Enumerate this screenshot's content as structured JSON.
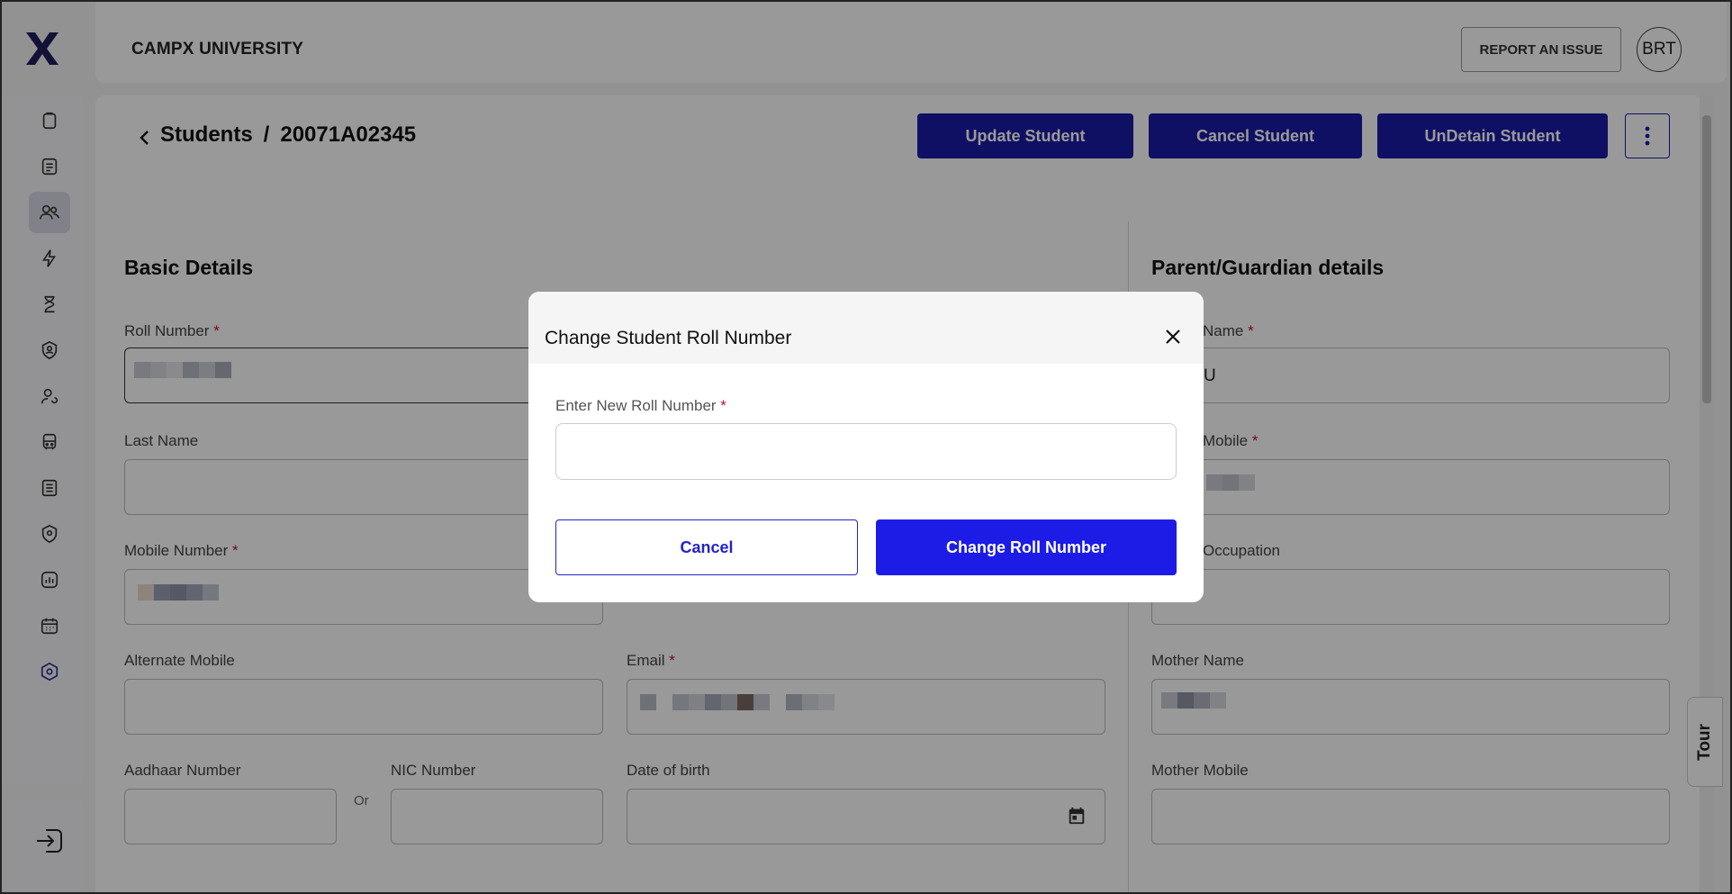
{
  "header": {
    "university": "CAMPX UNIVERSITY",
    "report_label": "REPORT AN ISSUE",
    "avatar_initials": "BRT"
  },
  "sidebar": {
    "items": [
      {
        "icon": "clipboard-icon"
      },
      {
        "icon": "document-icon"
      },
      {
        "icon": "users-icon",
        "active": true
      },
      {
        "icon": "lightning-icon"
      },
      {
        "icon": "hourglass-icon"
      },
      {
        "icon": "shield-user-icon"
      },
      {
        "icon": "user-refresh-icon"
      },
      {
        "icon": "bus-icon"
      },
      {
        "icon": "receipt-icon"
      },
      {
        "icon": "location-shield-icon"
      },
      {
        "icon": "chart-icon"
      },
      {
        "icon": "calendar-icon"
      },
      {
        "icon": "settings-hex-icon"
      }
    ],
    "logout_icon": "logout-icon"
  },
  "page": {
    "breadcrumb_root": "Students",
    "breadcrumb_sep": "/",
    "breadcrumb_current": "20071A02345",
    "actions": {
      "update": "Update Student",
      "cancel": "Cancel Student",
      "undetain": "UnDetain Student"
    }
  },
  "basic": {
    "title": "Basic Details",
    "roll_label": "Roll Number",
    "last_name_label": "Last Name",
    "mobile_label": "Mobile Number",
    "alt_mobile_label": "Alternate Mobile",
    "email_label": "Email",
    "aadhaar_label": "Aadhaar Number",
    "or_text": "Or",
    "nic_label": "NIC Number",
    "dob_label": "Date of birth"
  },
  "guardian": {
    "title": "Parent/Guardian details",
    "name_label_partial": "Name",
    "name_value_partial": "U",
    "mobile_label_partial": "Mobile",
    "occupation_label_partial": "Occupation",
    "mother_name_label": "Mother Name",
    "mother_mobile_label": "Mother Mobile"
  },
  "tour_label": "Tour",
  "modal": {
    "title": "Change Student Roll Number",
    "field_label": "Enter New Roll Number",
    "required_mark": "*",
    "input_value": "",
    "cancel_label": "Cancel",
    "submit_label": "Change Roll Number"
  },
  "colors": {
    "primary": "#1a1aa6",
    "modal_primary": "#1c1ce6",
    "required": "#c0142a",
    "overlay": "rgba(0,0,0,0.4)"
  }
}
